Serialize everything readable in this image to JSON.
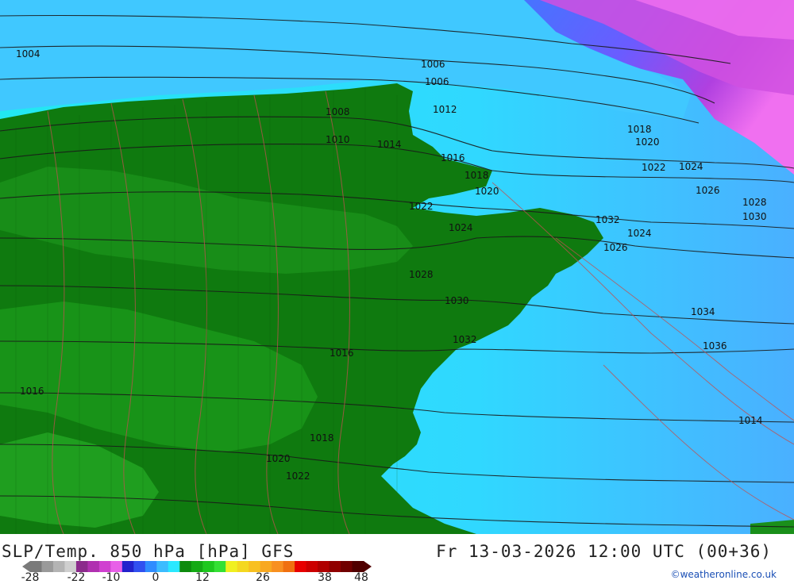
{
  "map": {
    "pressure_labels": [
      "1004",
      "1006",
      "1006",
      "1008",
      "1010",
      "1012",
      "1014",
      "1016",
      "1018",
      "1020",
      "1022",
      "1024",
      "1026",
      "1028",
      "1030",
      "1032",
      "1034",
      "1036",
      "1014",
      "1016",
      "1018",
      "1020",
      "1022",
      "1024",
      "1026",
      "1028",
      "1030",
      "1032",
      "1016",
      "1018",
      "1020",
      "1022",
      "1024"
    ],
    "colors": {
      "land_dark": "#0f7a0f",
      "land_mid": "#1a8f1a",
      "sea_cyan": "#1ee6f0",
      "sea_light": "#48d0ff",
      "sea_blue": "#3a7cff",
      "cold_purple": "#8a2be2",
      "cold_magenta": "#e040e0",
      "isobar": "#1a1a1a",
      "isotherm": "#c05050"
    }
  },
  "footer": {
    "title": "SLP/Temp. 850 hPa [hPa] GFS",
    "timestamp": "Fr 13-03-2026 12:00 UTC (00+36)",
    "credit": "©weatheronline.co.uk",
    "scale_ticks": [
      "-28",
      "-22",
      "-10",
      "0",
      "12",
      "26",
      "38",
      "48"
    ],
    "scale_colors": [
      "#7a7a7a",
      "#9a9a9a",
      "#b4b4b4",
      "#cfcfcf",
      "#8b2a8b",
      "#b030b0",
      "#d040d0",
      "#e860e8",
      "#2222cc",
      "#3050f0",
      "#2f8cff",
      "#3cbcff",
      "#2ae8ff",
      "#0d8a0d",
      "#14aa14",
      "#1ec81e",
      "#34e034",
      "#f0f020",
      "#f4d820",
      "#f8c020",
      "#f8a820",
      "#f89020",
      "#f07010",
      "#e80000",
      "#cc0000",
      "#b00000",
      "#900000",
      "#700000",
      "#500000"
    ]
  }
}
